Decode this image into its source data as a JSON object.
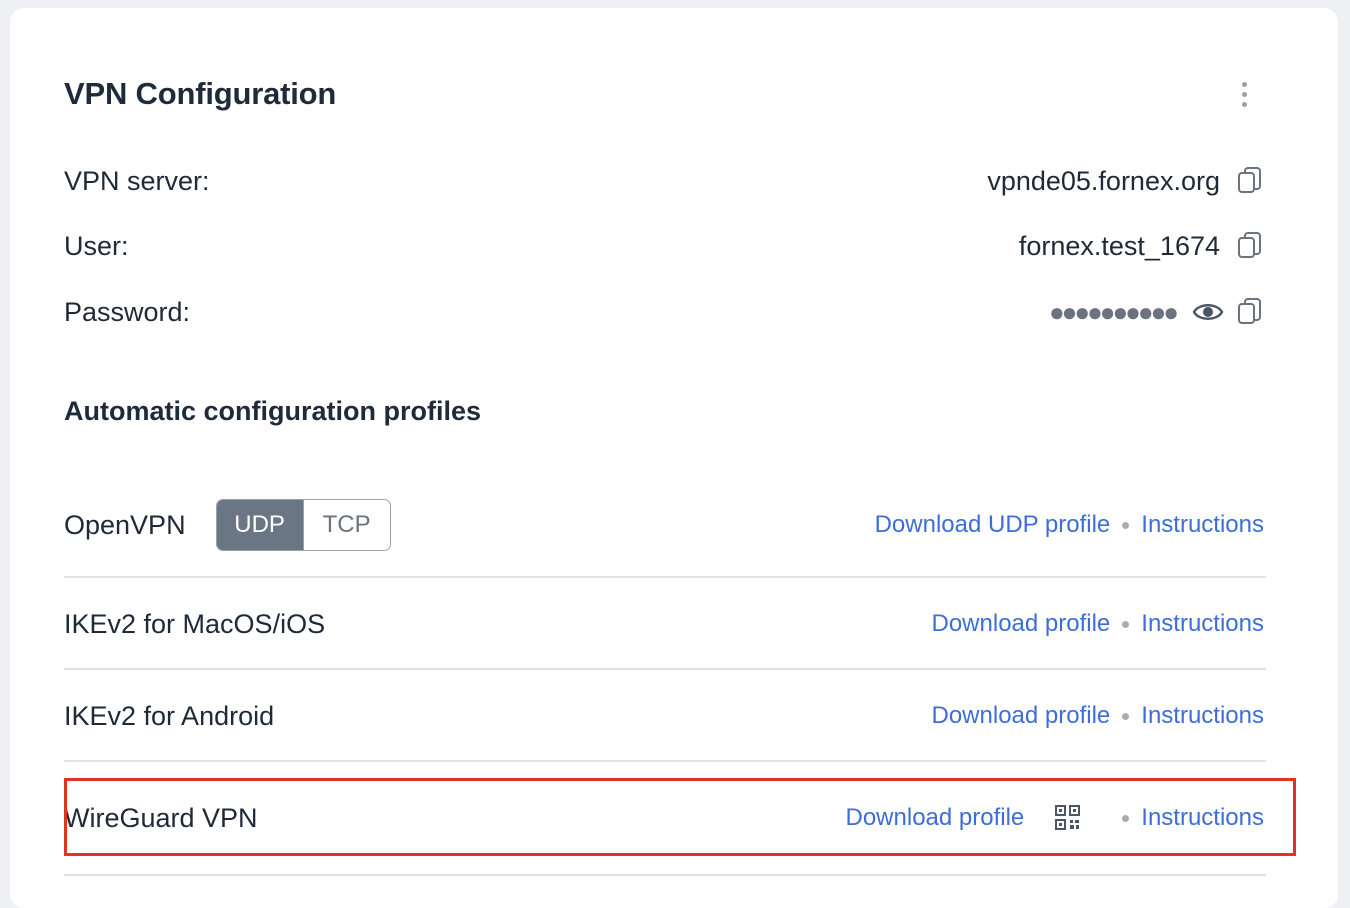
{
  "header": {
    "title": "VPN Configuration"
  },
  "fields": {
    "server_label": "VPN server:",
    "server_value": "vpnde05.fornex.org",
    "user_label": "User:",
    "user_value": "fornex.test_1674",
    "password_label": "Password:",
    "password_value": "●●●●●●●●●●"
  },
  "profiles": {
    "section_title": "Automatic configuration profiles",
    "openvpn": {
      "name": "OpenVPN",
      "toggle": [
        "UDP",
        "TCP"
      ],
      "selected": "UDP",
      "download_label": "Download UDP profile",
      "instructions_label": "Instructions"
    },
    "ikev2_mac": {
      "name": "IKEv2 for MacOS/iOS",
      "download_label": "Download profile",
      "instructions_label": "Instructions"
    },
    "ikev2_android": {
      "name": "IKEv2 for Android",
      "download_label": "Download profile",
      "instructions_label": "Instructions"
    },
    "wireguard": {
      "name": "WireGuard VPN",
      "download_label": "Download profile",
      "instructions_label": "Instructions"
    }
  },
  "icons": {
    "menu": "kebab-menu-icon",
    "copy": "copy-icon",
    "reveal": "eye-icon",
    "qr": "qr-code-icon"
  },
  "colors": {
    "link": "#3d6ed8",
    "toggle_active": "#6b7685",
    "highlight": "#e03621"
  }
}
